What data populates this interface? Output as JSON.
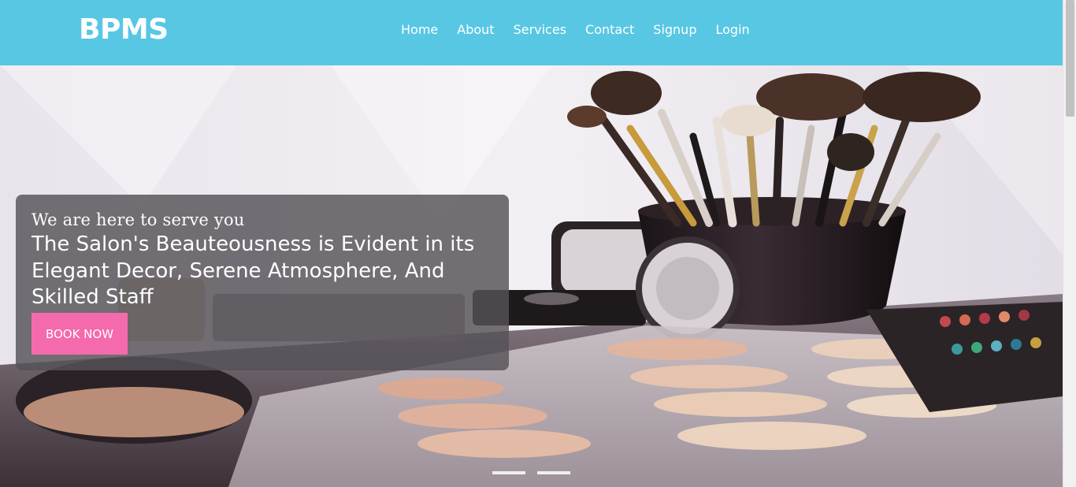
{
  "brand": "BPMS",
  "nav": {
    "items": [
      {
        "label": "Home"
      },
      {
        "label": "About"
      },
      {
        "label": "Services"
      },
      {
        "label": "Contact"
      },
      {
        "label": "Signup"
      },
      {
        "label": "Login"
      }
    ]
  },
  "hero": {
    "subtitle": "We are here to serve you",
    "title": "The Salon's Beauteousness is Evident in its Elegant Decor, Serene Atmosphere, And Skilled Staff",
    "cta_label": "BOOK NOW",
    "background_image": "makeup-brushes-and-palette-photo",
    "slides_count": 2
  },
  "colors": {
    "navbar": "#58c7e3",
    "cta": "#f56aad",
    "caption_bg": "#555258"
  }
}
